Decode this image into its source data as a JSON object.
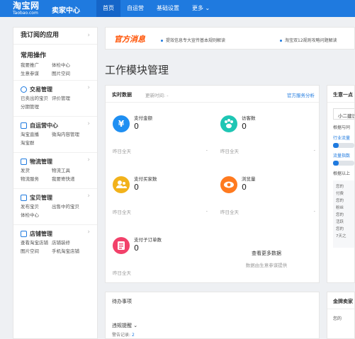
{
  "header": {
    "logo_cn": "淘宝网",
    "logo_en": "Taobao.com",
    "seller_center": "卖家中心",
    "nav": [
      "首页",
      "自运营",
      "基础设置",
      "更多 ⌄"
    ]
  },
  "sidebar": {
    "subscribed": "我订阅的应用",
    "chev": "›",
    "common_title": "常用操作",
    "common_links": [
      "我要推广",
      "体检中心",
      "生意参谋",
      "图片空间"
    ],
    "groups": [
      {
        "title": "交易管理",
        "links": [
          "已卖出的宝贝",
          "评价管理",
          "分期管理"
        ]
      },
      {
        "title": "自运营中心",
        "links": [
          "淘宝直播",
          "微淘内容管理",
          "淘宝群"
        ]
      },
      {
        "title": "物流管理",
        "links": [
          "发货",
          "物流工具",
          "物流服务",
          "我要寄快递"
        ]
      },
      {
        "title": "宝贝管理",
        "links": [
          "发布宝贝",
          "出售中的宝贝",
          "体检中心"
        ]
      },
      {
        "title": "店铺管理",
        "links": [
          "查看淘宝店铺",
          "店铺装修",
          "图片空间",
          "手机淘宝店铺"
        ]
      }
    ]
  },
  "notice": {
    "title": "官方消息",
    "items": [
      "提效信息专大宣传基本规则解读",
      "淘宝双12规则攻略问题解读"
    ]
  },
  "page_title": "工作模块管理",
  "realtime": {
    "title": "实时数据",
    "update": "更新时间: -",
    "link": "官方服务分析",
    "metrics": [
      {
        "label": "支付金额",
        "value": "0",
        "icon": "¥",
        "color": "#1f8ff2",
        "foot": "昨日全天",
        "dash": "-"
      },
      {
        "label": "访客数",
        "value": "0",
        "icon": "paw-icon",
        "color": "#1fc6b4",
        "foot": "昨日全天",
        "dash": "-"
      },
      {
        "label": "支付买家数",
        "value": "0",
        "icon": "user-icon",
        "color": "#f2b21b",
        "foot": "昨日全天",
        "dash": "-"
      },
      {
        "label": "浏览量",
        "value": "0",
        "icon": "eye-icon",
        "color": "#ff7a1f",
        "foot": "昨日全天",
        "dash": "-"
      },
      {
        "label": "支付子订单数",
        "value": "0",
        "icon": "order-icon",
        "color": "#f2416a",
        "foot": "昨日全天",
        "dash": "-"
      }
    ],
    "more_title": "查看更多数据",
    "more_sub": "数据由生意参谋提供"
  },
  "todo": {
    "title": "待办事项",
    "sub": "违规提醒 ⌄",
    "sub2_label": "警告记录:",
    "sub2_value": "2"
  },
  "right_panel": {
    "title": "生意一点",
    "tab": "小二建议",
    "label": "根据与同",
    "links": [
      "行业流量",
      "流量指数"
    ],
    "label2": "根据以上",
    "box": [
      "您的",
      "付费",
      "您的",
      "粉丝",
      "您的",
      "活跃",
      "您的",
      "7天之"
    ]
  },
  "right_panel2": {
    "title": "金牌卖家",
    "line": "您的"
  }
}
